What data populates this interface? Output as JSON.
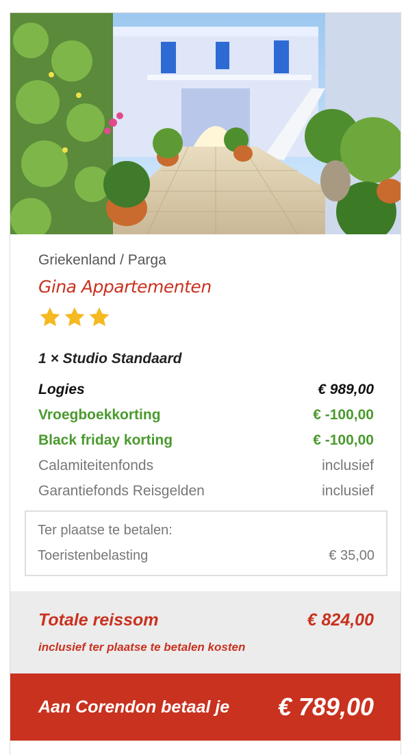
{
  "hero": {
    "image_icon": "courtyard-photo"
  },
  "location": "Griekenland / Parga",
  "hotel": {
    "name": "Gina Appartementen",
    "stars": 3,
    "star_color": "#f5b921"
  },
  "room": "1 × Studio Standaard",
  "price_lines": [
    {
      "label": "Logies",
      "value": "€ 989,00",
      "style": "dark"
    },
    {
      "label": "Vroegboekkorting",
      "value": "€ -100,00",
      "style": "green"
    },
    {
      "label": "Black friday korting",
      "value": "€ -100,00",
      "style": "green"
    },
    {
      "label": "Calamiteitenfonds",
      "value": "inclusief",
      "style": "grey"
    },
    {
      "label": "Garantiefonds Reisgelden",
      "value": "inclusief",
      "style": "grey"
    }
  ],
  "onsite": {
    "title": "Ter plaatse te betalen:",
    "label": "Toeristenbelasting",
    "value": "€ 35,00"
  },
  "total": {
    "label": "Totale reissom",
    "value": "€ 824,00",
    "note": "inclusief ter plaatse te betalen kosten"
  },
  "pay": {
    "label": "Aan Corendon betaal je",
    "value": "€ 789,00"
  },
  "colors": {
    "accent": "#c8321f",
    "discount": "#4a9a2e",
    "grey_band": "#ececec"
  }
}
